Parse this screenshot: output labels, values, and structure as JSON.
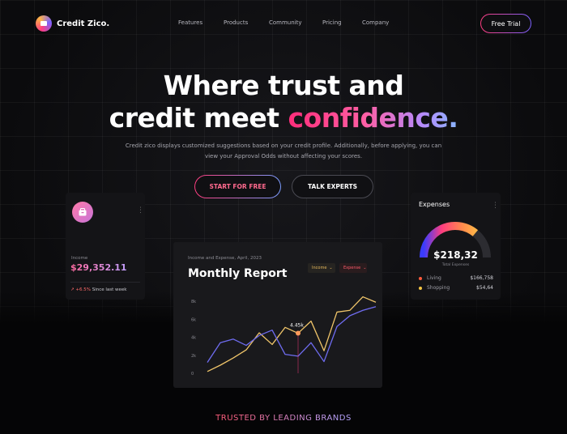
{
  "nav": {
    "brand": "Credit Zico.",
    "links": [
      "Features",
      "Products",
      "Community",
      "Pricing",
      "Company"
    ],
    "trial_label": "Free Trial"
  },
  "hero": {
    "line1": "Where trust and",
    "line2_prefix": "credit meet",
    "line2_highlight": "confidence.",
    "subtitle": "Credit zico displays customized suggestions based on your credit profile. Additionally, before applying, you can view your Approval Odds without affecting your scores.",
    "cta_primary": "START FOR FREE",
    "cta_secondary": "TALK EXPERTS"
  },
  "income_card": {
    "icon": "wallet-icon",
    "label": "Income",
    "value": "$29,352.11",
    "trend_value": "+6.5%",
    "trend_text": "Since last week"
  },
  "expenses_card": {
    "title": "Expenses",
    "total": "$218,32",
    "total_label": "Total Expenses",
    "gauge_fraction": 0.72,
    "items": [
      {
        "label": "Living",
        "amount": "$166,758",
        "color": "#ff5a3c"
      },
      {
        "label": "Shopping",
        "amount": "$54,64",
        "color": "#f5c542"
      }
    ]
  },
  "report_card": {
    "subtitle": "Income and Expense, April, 2023",
    "title": "Monthly Report",
    "filter_income": "Income",
    "filter_expense": "Expense",
    "tooltip": "4.45k"
  },
  "chart_data": {
    "type": "line",
    "title": "Monthly Report",
    "ylim": [
      0,
      9000
    ],
    "y_ticks": [
      "0",
      "2k",
      "4k",
      "6k",
      "8k"
    ],
    "series": [
      {
        "name": "Income",
        "color": "#f0c56a",
        "values": [
          200,
          900,
          1700,
          2600,
          4500,
          3200,
          5100,
          4450,
          5800,
          2500,
          6800,
          7000,
          8500,
          7900
        ]
      },
      {
        "name": "Expense",
        "color": "#6f6cf0",
        "values": [
          1200,
          3400,
          3800,
          3100,
          4200,
          4800,
          2100,
          1900,
          3400,
          1300,
          5200,
          6400,
          7000,
          7400
        ]
      }
    ],
    "gradient_accent": "#ff3d7f"
  },
  "footer": {
    "trusted": "TRUSTED BY LEADING BRANDS"
  }
}
